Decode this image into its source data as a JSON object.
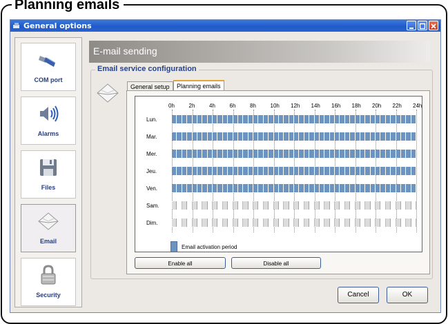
{
  "frame": {
    "title": "Planning emails"
  },
  "window": {
    "title": "General options"
  },
  "sidebar": {
    "items": [
      {
        "label": "COM port",
        "icon": "usb-plug-icon"
      },
      {
        "label": "Alarms",
        "icon": "speaker-icon"
      },
      {
        "label": "Files",
        "icon": "floppy-disk-icon"
      },
      {
        "label": "Email",
        "icon": "envelope-icon",
        "active": true
      },
      {
        "label": "Security",
        "icon": "padlock-icon"
      }
    ]
  },
  "banner": {
    "title": "E-mail sending"
  },
  "group": {
    "title": "Email service configuration"
  },
  "tabs": [
    {
      "label": "General setup"
    },
    {
      "label": "Planning emails",
      "active": true
    }
  ],
  "schedule": {
    "hours": [
      "0h",
      "2h",
      "4h",
      "6h",
      "8h",
      "10h",
      "12h",
      "14h",
      "16h",
      "18h",
      "20h",
      "22h",
      "24h"
    ],
    "days": [
      {
        "label": "Lun.",
        "active": true
      },
      {
        "label": "Mar.",
        "active": true
      },
      {
        "label": "Mer.",
        "active": true
      },
      {
        "label": "Jeu.",
        "active": true
      },
      {
        "label": "Ven.",
        "active": true
      },
      {
        "label": "Sam.",
        "active": false
      },
      {
        "label": "Dim.",
        "active": false
      }
    ],
    "legend": "Email activation period",
    "active_color": "#6c94bf"
  },
  "buttons": {
    "enable_all": "Enable all",
    "disable_all": "Disable all",
    "cancel": "Cancel",
    "ok": "OK"
  }
}
